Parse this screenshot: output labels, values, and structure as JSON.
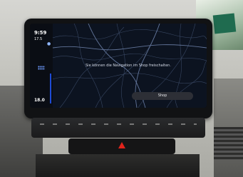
{
  "screen": {
    "clock": "9:59",
    "outside_temp": "17.5",
    "left_temp": "18.0",
    "message": "Sie können die Navigation im Shop freischalten.",
    "shop_button": "Shop"
  },
  "colors": {
    "accent": "#1e4bd6",
    "hazard": "#e0231b",
    "screen_bg": "#0b1018"
  }
}
